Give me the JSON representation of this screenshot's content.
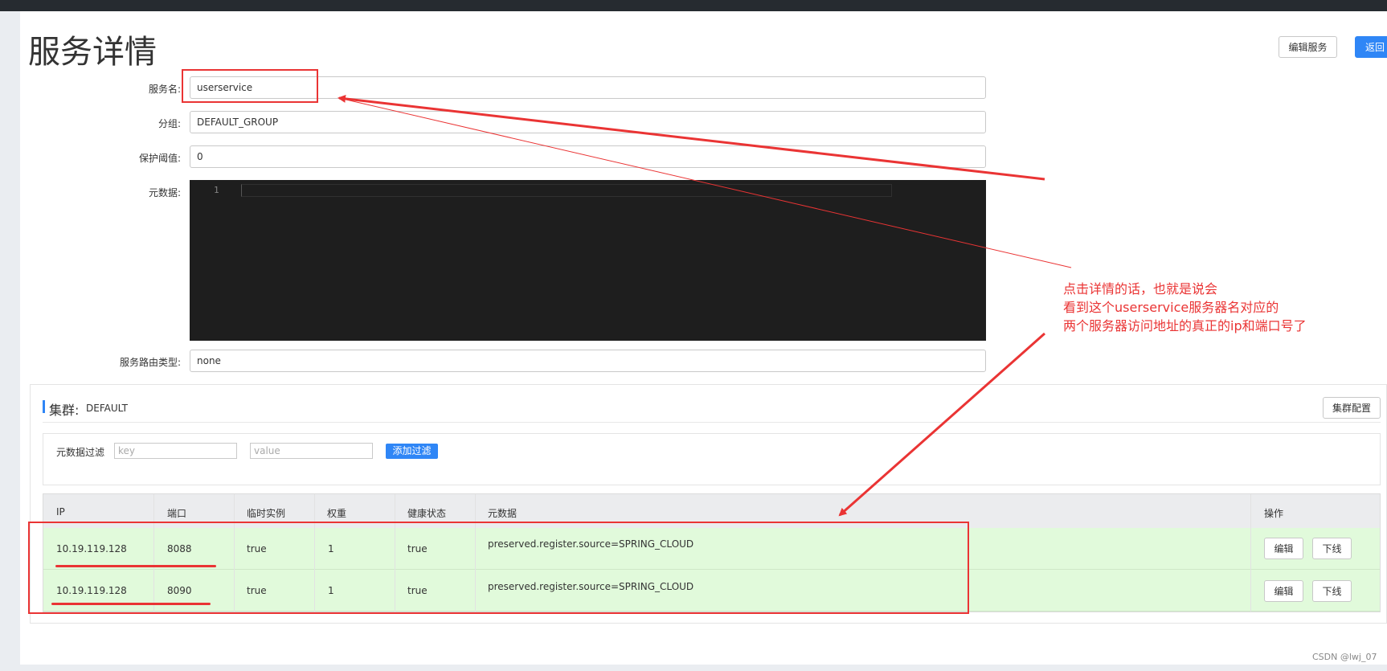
{
  "page": {
    "title": "服务详情",
    "edit_service_label": "编辑服务",
    "back_label": "返回"
  },
  "form": {
    "service_name": {
      "label": "服务名:",
      "value": "userservice"
    },
    "group": {
      "label": "分组:",
      "value": "DEFAULT_GROUP"
    },
    "protect_threshold": {
      "label": "保护阈值:",
      "value": "0"
    },
    "metadata": {
      "label": "元数据:",
      "line_number": "1"
    },
    "route_type": {
      "label": "服务路由类型:",
      "value": "none"
    }
  },
  "cluster": {
    "title": "集群:",
    "name": "DEFAULT",
    "config_label": "集群配置",
    "filter": {
      "label": "元数据过滤",
      "key_placeholder": "key",
      "value_placeholder": "value",
      "add_label": "添加过滤"
    },
    "table": {
      "columns": [
        "IP",
        "端口",
        "临时实例",
        "权重",
        "健康状态",
        "元数据",
        "操作"
      ],
      "rows": [
        {
          "ip": "10.19.119.128",
          "port": "8088",
          "ephemeral": "true",
          "weight": "1",
          "healthy": "true",
          "metadata": "preserved.register.source=SPRING_CLOUD",
          "edit_label": "编辑",
          "offline_label": "下线"
        },
        {
          "ip": "10.19.119.128",
          "port": "8090",
          "ephemeral": "true",
          "weight": "1",
          "healthy": "true",
          "metadata": "preserved.register.source=SPRING_CLOUD",
          "edit_label": "编辑",
          "offline_label": "下线"
        }
      ]
    }
  },
  "annotation": {
    "lines": [
      "点击详情的话，也就是说会",
      "看到这个userservice服务器名对应的",
      "两个服务器访问地址的真正的ip和端口号了"
    ],
    "color": "#ea3434"
  },
  "watermark": "CSDN @lwj_07",
  "colors": {
    "primary": "#2f86f6",
    "row_bg": "#e1fadb",
    "editor_bg": "#1e1e1e",
    "annotation": "#ea3434"
  }
}
